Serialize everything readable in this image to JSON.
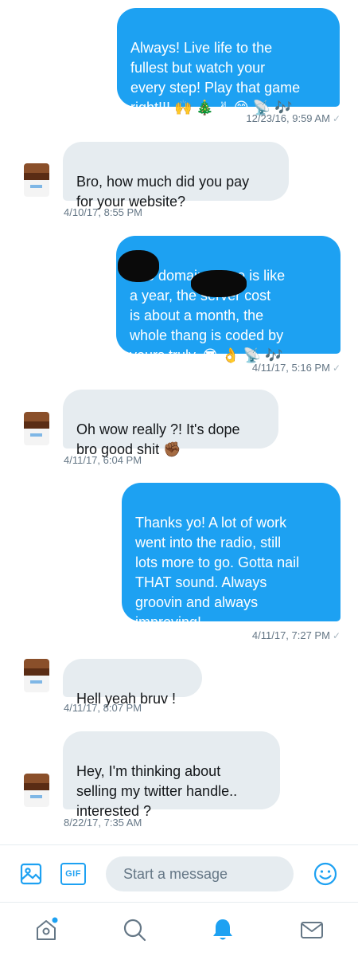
{
  "colors": {
    "accent": "#1da1f2",
    "incoming_bubble": "#e6ecf0",
    "timestamp": "#657786"
  },
  "messages": [
    {
      "direction": "outgoing",
      "text": "Always! Live life to the\nfullest but watch your\nevery step! Play that game\nright!!! 🙌 🎄 ✌ 😄 📡 🎶",
      "time": "12/23/16, 9:59 AM"
    },
    {
      "direction": "incoming",
      "text": "Bro, how much did you pay\nfor your website?",
      "time": "4/10/17, 8:55 PM"
    },
    {
      "direction": "outgoing",
      "text": "The domain name is like\n        a year, the server cost\nis about          a month, the\nwhole thang is coded by\nyours truly. 😎 👌 📡 🎶",
      "time": "4/11/17, 5:16 PM"
    },
    {
      "direction": "incoming",
      "text": "Oh wow really ?! It's dope\nbro good shit ✊🏾",
      "time": "4/11/17, 6:04 PM"
    },
    {
      "direction": "outgoing",
      "text": "Thanks yo! A lot of work\nwent into the radio, still\nlots more to go. Gotta nail\nTHAT sound. Always\ngroovin and always\nimproving!",
      "time": "4/11/17, 7:27 PM"
    },
    {
      "direction": "incoming",
      "text": "Hell yeah bruv !",
      "time": "4/11/17, 8:07 PM"
    },
    {
      "direction": "incoming",
      "text": "Hey, I'm thinking about\nselling my twitter handle..\ninterested ?",
      "time": "8/22/17, 7:35 AM"
    }
  ],
  "read_mark": "✓",
  "composer": {
    "placeholder": "Start a message",
    "gif_label": "GIF",
    "icons": [
      "image-icon",
      "gif-icon",
      "emoji-icon"
    ]
  },
  "tabs": [
    {
      "icon": "home-icon",
      "active": false,
      "has_dot": true
    },
    {
      "icon": "search-icon",
      "active": false
    },
    {
      "icon": "notifications-icon",
      "active": true
    },
    {
      "icon": "messages-icon",
      "active": false
    }
  ]
}
